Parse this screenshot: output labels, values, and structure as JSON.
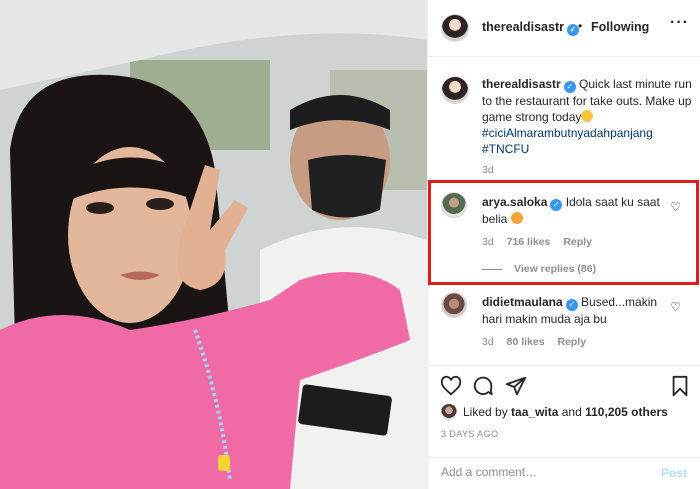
{
  "post": {
    "username": "therealdisastr",
    "follow_status": "Following",
    "more_icon": "more-horizontal-icon",
    "caption_text": "Quick last minute run to the restaurant for take outs. Make up game strong today",
    "hashtags": [
      "#ciciAlmarambutnyadahpanjang",
      "#TNCFU"
    ],
    "caption_time": "3d"
  },
  "comments": [
    {
      "username": "arya.saloka",
      "text": "Idola saat ku saat belia",
      "time": "3d",
      "likes": "716 likes",
      "reply_label": "Reply",
      "view_replies": "View replies (86)"
    },
    {
      "username": "didietmaulana",
      "text": "Bused...makin hari makin muda aja bu",
      "time": "3d",
      "likes": "80 likes",
      "reply_label": "Reply"
    }
  ],
  "actions": {
    "icons": [
      "heart-icon",
      "comment-icon",
      "share-icon",
      "bookmark-icon"
    ],
    "liked_by_prefix": "Liked by",
    "liked_by_user": "taa_wita",
    "liked_by_and": "and",
    "liked_by_count": "110,205 others",
    "date": "3 DAYS AGO"
  },
  "add_comment": {
    "placeholder": "Add a comment…",
    "post_label": "Post"
  },
  "colors": {
    "accent_blue": "#3897f0",
    "highlight_red": "#e01b1b",
    "hashtag_blue": "#00376b",
    "muted_gray": "#8e8e8e"
  }
}
